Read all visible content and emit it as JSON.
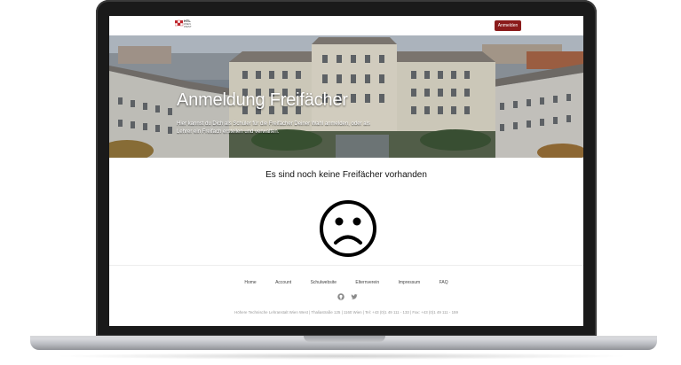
{
  "header": {
    "logo_lines": [
      "HTL",
      "WIEN",
      "WEST"
    ],
    "login_label": "Anmelden"
  },
  "hero": {
    "title": "Anmeldung Freifächer",
    "text": "Hier kannst du Dich als Schüler für die Freifächer Deiner Wahl anmelden, oder als Lehrer ein Freifach erstellen und verwalten."
  },
  "main": {
    "empty_message": "Es sind noch keine Freifächer vorhanden",
    "icon": "sad-face-icon"
  },
  "footer": {
    "links": [
      "Home",
      "Account",
      "Schulwebsite",
      "Elternverein",
      "Impressum",
      "FAQ"
    ],
    "social": [
      "github-icon",
      "twitter-icon"
    ],
    "address": "Höhere Technische Lehranstalt Wien West | Thaliastraße 125 | 1160 Wien | Tel: +43 (0)1 49 111 - 133 | Fax: +43 (0)1 49 111 - 159"
  },
  "colors": {
    "brand": "#8a1b1b",
    "text": "#111111",
    "footer_text": "#999999"
  }
}
